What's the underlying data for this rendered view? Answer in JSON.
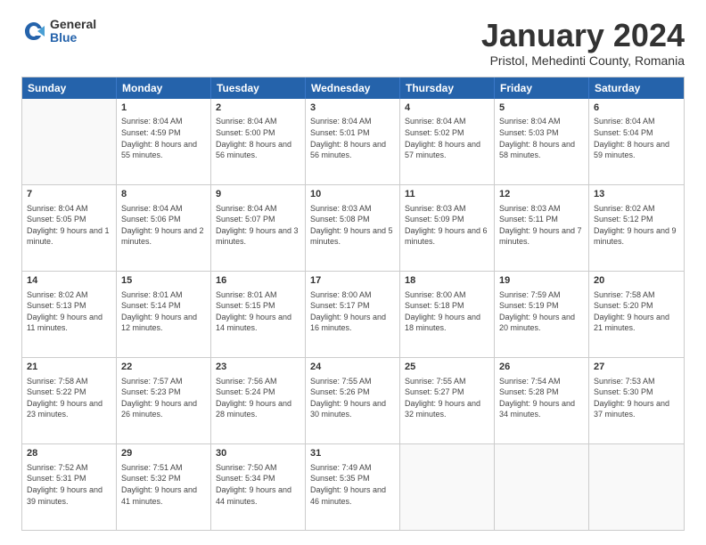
{
  "logo": {
    "general": "General",
    "blue": "Blue"
  },
  "title": "January 2024",
  "subtitle": "Pristol, Mehedinti County, Romania",
  "header_days": [
    "Sunday",
    "Monday",
    "Tuesday",
    "Wednesday",
    "Thursday",
    "Friday",
    "Saturday"
  ],
  "weeks": [
    [
      {
        "day": "",
        "sunrise": "",
        "sunset": "",
        "daylight": ""
      },
      {
        "day": "1",
        "sunrise": "Sunrise: 8:04 AM",
        "sunset": "Sunset: 4:59 PM",
        "daylight": "Daylight: 8 hours and 55 minutes."
      },
      {
        "day": "2",
        "sunrise": "Sunrise: 8:04 AM",
        "sunset": "Sunset: 5:00 PM",
        "daylight": "Daylight: 8 hours and 56 minutes."
      },
      {
        "day": "3",
        "sunrise": "Sunrise: 8:04 AM",
        "sunset": "Sunset: 5:01 PM",
        "daylight": "Daylight: 8 hours and 56 minutes."
      },
      {
        "day": "4",
        "sunrise": "Sunrise: 8:04 AM",
        "sunset": "Sunset: 5:02 PM",
        "daylight": "Daylight: 8 hours and 57 minutes."
      },
      {
        "day": "5",
        "sunrise": "Sunrise: 8:04 AM",
        "sunset": "Sunset: 5:03 PM",
        "daylight": "Daylight: 8 hours and 58 minutes."
      },
      {
        "day": "6",
        "sunrise": "Sunrise: 8:04 AM",
        "sunset": "Sunset: 5:04 PM",
        "daylight": "Daylight: 8 hours and 59 minutes."
      }
    ],
    [
      {
        "day": "7",
        "sunrise": "Sunrise: 8:04 AM",
        "sunset": "Sunset: 5:05 PM",
        "daylight": "Daylight: 9 hours and 1 minute."
      },
      {
        "day": "8",
        "sunrise": "Sunrise: 8:04 AM",
        "sunset": "Sunset: 5:06 PM",
        "daylight": "Daylight: 9 hours and 2 minutes."
      },
      {
        "day": "9",
        "sunrise": "Sunrise: 8:04 AM",
        "sunset": "Sunset: 5:07 PM",
        "daylight": "Daylight: 9 hours and 3 minutes."
      },
      {
        "day": "10",
        "sunrise": "Sunrise: 8:03 AM",
        "sunset": "Sunset: 5:08 PM",
        "daylight": "Daylight: 9 hours and 5 minutes."
      },
      {
        "day": "11",
        "sunrise": "Sunrise: 8:03 AM",
        "sunset": "Sunset: 5:09 PM",
        "daylight": "Daylight: 9 hours and 6 minutes."
      },
      {
        "day": "12",
        "sunrise": "Sunrise: 8:03 AM",
        "sunset": "Sunset: 5:11 PM",
        "daylight": "Daylight: 9 hours and 7 minutes."
      },
      {
        "day": "13",
        "sunrise": "Sunrise: 8:02 AM",
        "sunset": "Sunset: 5:12 PM",
        "daylight": "Daylight: 9 hours and 9 minutes."
      }
    ],
    [
      {
        "day": "14",
        "sunrise": "Sunrise: 8:02 AM",
        "sunset": "Sunset: 5:13 PM",
        "daylight": "Daylight: 9 hours and 11 minutes."
      },
      {
        "day": "15",
        "sunrise": "Sunrise: 8:01 AM",
        "sunset": "Sunset: 5:14 PM",
        "daylight": "Daylight: 9 hours and 12 minutes."
      },
      {
        "day": "16",
        "sunrise": "Sunrise: 8:01 AM",
        "sunset": "Sunset: 5:15 PM",
        "daylight": "Daylight: 9 hours and 14 minutes."
      },
      {
        "day": "17",
        "sunrise": "Sunrise: 8:00 AM",
        "sunset": "Sunset: 5:17 PM",
        "daylight": "Daylight: 9 hours and 16 minutes."
      },
      {
        "day": "18",
        "sunrise": "Sunrise: 8:00 AM",
        "sunset": "Sunset: 5:18 PM",
        "daylight": "Daylight: 9 hours and 18 minutes."
      },
      {
        "day": "19",
        "sunrise": "Sunrise: 7:59 AM",
        "sunset": "Sunset: 5:19 PM",
        "daylight": "Daylight: 9 hours and 20 minutes."
      },
      {
        "day": "20",
        "sunrise": "Sunrise: 7:58 AM",
        "sunset": "Sunset: 5:20 PM",
        "daylight": "Daylight: 9 hours and 21 minutes."
      }
    ],
    [
      {
        "day": "21",
        "sunrise": "Sunrise: 7:58 AM",
        "sunset": "Sunset: 5:22 PM",
        "daylight": "Daylight: 9 hours and 23 minutes."
      },
      {
        "day": "22",
        "sunrise": "Sunrise: 7:57 AM",
        "sunset": "Sunset: 5:23 PM",
        "daylight": "Daylight: 9 hours and 26 minutes."
      },
      {
        "day": "23",
        "sunrise": "Sunrise: 7:56 AM",
        "sunset": "Sunset: 5:24 PM",
        "daylight": "Daylight: 9 hours and 28 minutes."
      },
      {
        "day": "24",
        "sunrise": "Sunrise: 7:55 AM",
        "sunset": "Sunset: 5:26 PM",
        "daylight": "Daylight: 9 hours and 30 minutes."
      },
      {
        "day": "25",
        "sunrise": "Sunrise: 7:55 AM",
        "sunset": "Sunset: 5:27 PM",
        "daylight": "Daylight: 9 hours and 32 minutes."
      },
      {
        "day": "26",
        "sunrise": "Sunrise: 7:54 AM",
        "sunset": "Sunset: 5:28 PM",
        "daylight": "Daylight: 9 hours and 34 minutes."
      },
      {
        "day": "27",
        "sunrise": "Sunrise: 7:53 AM",
        "sunset": "Sunset: 5:30 PM",
        "daylight": "Daylight: 9 hours and 37 minutes."
      }
    ],
    [
      {
        "day": "28",
        "sunrise": "Sunrise: 7:52 AM",
        "sunset": "Sunset: 5:31 PM",
        "daylight": "Daylight: 9 hours and 39 minutes."
      },
      {
        "day": "29",
        "sunrise": "Sunrise: 7:51 AM",
        "sunset": "Sunset: 5:32 PM",
        "daylight": "Daylight: 9 hours and 41 minutes."
      },
      {
        "day": "30",
        "sunrise": "Sunrise: 7:50 AM",
        "sunset": "Sunset: 5:34 PM",
        "daylight": "Daylight: 9 hours and 44 minutes."
      },
      {
        "day": "31",
        "sunrise": "Sunrise: 7:49 AM",
        "sunset": "Sunset: 5:35 PM",
        "daylight": "Daylight: 9 hours and 46 minutes."
      },
      {
        "day": "",
        "sunrise": "",
        "sunset": "",
        "daylight": ""
      },
      {
        "day": "",
        "sunrise": "",
        "sunset": "",
        "daylight": ""
      },
      {
        "day": "",
        "sunrise": "",
        "sunset": "",
        "daylight": ""
      }
    ]
  ]
}
